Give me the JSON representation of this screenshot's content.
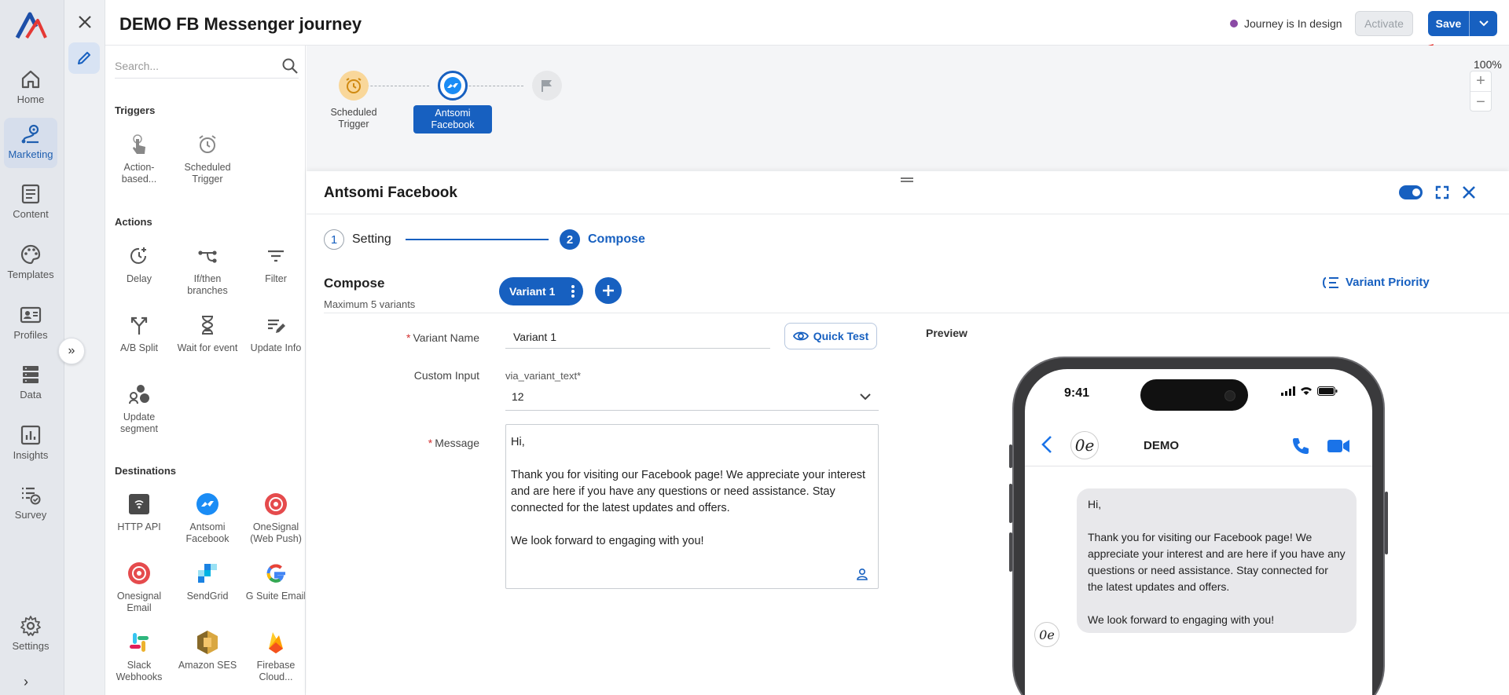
{
  "nav": {
    "items": [
      {
        "label": "Home",
        "icon": "home-icon"
      },
      {
        "label": "Marketing",
        "icon": "marketing-icon",
        "active": true
      },
      {
        "label": "Content",
        "icon": "content-icon"
      },
      {
        "label": "Templates",
        "icon": "palette-icon"
      },
      {
        "label": "Profiles",
        "icon": "profile-card-icon"
      },
      {
        "label": "Data",
        "icon": "database-icon"
      },
      {
        "label": "Insights",
        "icon": "chart-icon"
      },
      {
        "label": "Survey",
        "icon": "survey-icon"
      }
    ],
    "settings_label": "Settings"
  },
  "header": {
    "title": "DEMO FB Messenger journey",
    "status": "Journey is In design",
    "status_color": "#8b4aa5",
    "activate_label": "Activate",
    "save_label": "Save",
    "accent": "#1760c0"
  },
  "palette": {
    "search_placeholder": "Search...",
    "sections": {
      "triggers": {
        "title": "Triggers",
        "items": [
          "Action-based...",
          "Scheduled Trigger"
        ]
      },
      "actions": {
        "title": "Actions",
        "items": [
          "Delay",
          "If/then branches",
          "Filter",
          "A/B Split",
          "Wait for event",
          "Update Info",
          "Update segment"
        ]
      },
      "destinations": {
        "title": "Destinations",
        "items": [
          "HTTP API",
          "Antsomi Facebook",
          "OneSignal (Web Push)",
          "Onesignal Email",
          "SendGrid",
          "G Suite Email",
          "Slack Webhooks",
          "Amazon SES",
          "Firebase Cloud..."
        ]
      }
    }
  },
  "canvas": {
    "nodes": [
      {
        "label": "Scheduled Trigger",
        "icon": "alarm-clock-icon"
      },
      {
        "label": "Antsomi Facebook",
        "icon": "messenger-icon",
        "selected": true
      },
      {
        "label": "",
        "icon": "flag-icon"
      }
    ],
    "zoom": "100%"
  },
  "panel": {
    "title": "Antsomi Facebook",
    "steps": [
      {
        "num": "1",
        "label": "Setting"
      },
      {
        "num": "2",
        "label": "Compose"
      }
    ],
    "compose_title": "Compose",
    "compose_sub": "Maximum 5 variants",
    "variant_tab": "Variant 1",
    "variant_priority": "Variant Priority",
    "form": {
      "variant_name_label": "Variant Name",
      "variant_name_value": "Variant 1",
      "quick_test": "Quick Test",
      "custom_input_label": "Custom Input",
      "custom_input_hint": "via_variant_text*",
      "custom_input_value": "12",
      "message_label": "Message",
      "message": {
        "greeting": "Hi,",
        "body": "Thank you for visiting our Facebook page! We appreciate your interest and are here if you have any questions or need assistance. Stay connected for the latest updates and offers.",
        "closing": "We look forward to engaging with you!"
      }
    },
    "preview_label": "Preview",
    "phone": {
      "time": "9:41",
      "contact": "DEMO",
      "avatar_text": "0e"
    }
  }
}
